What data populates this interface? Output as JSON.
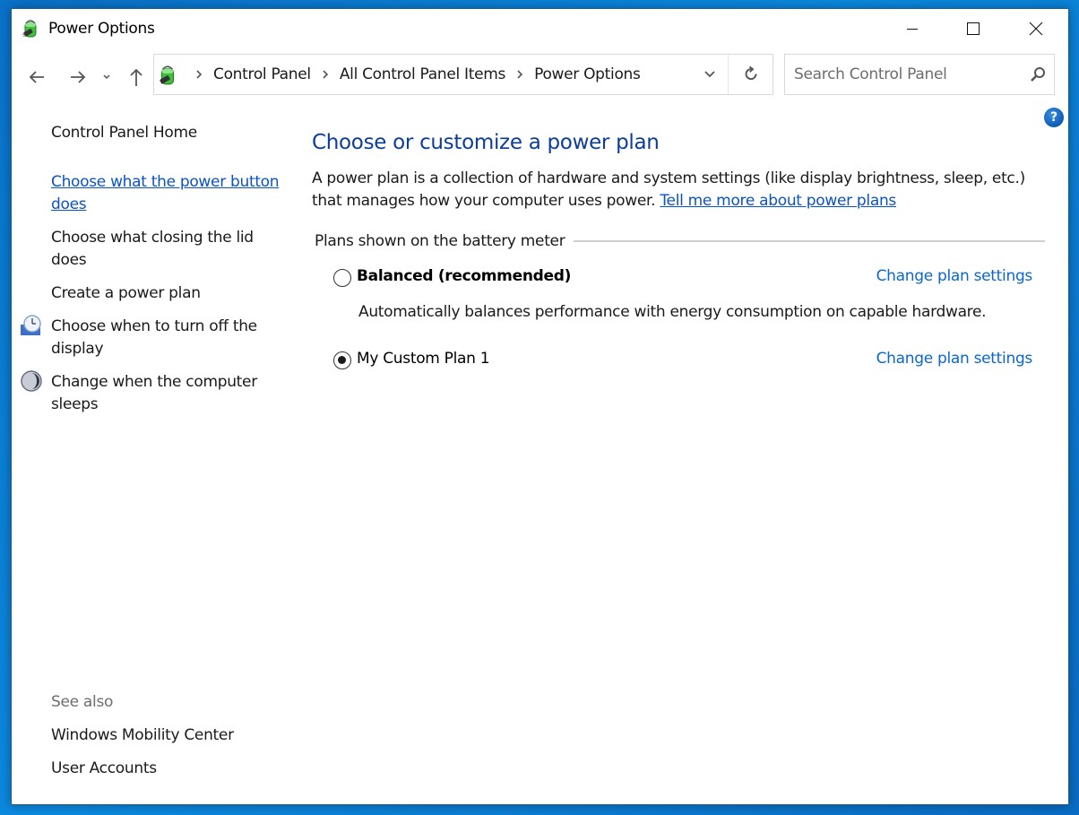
{
  "window": {
    "title": "Power Options",
    "controls": {
      "minimize": "minimize",
      "maximize": "maximize",
      "close": "close"
    }
  },
  "navigation": {
    "breadcrumbs": [
      "Control Panel",
      "All Control Panel Items",
      "Power Options"
    ],
    "search": {
      "placeholder": "Search Control Panel",
      "value": ""
    }
  },
  "sidebar": {
    "home_label": "Control Panel Home",
    "tasks": [
      {
        "label": "Choose what the power button does",
        "icon": null,
        "active": true
      },
      {
        "label": "Choose what closing the lid does",
        "icon": null,
        "active": false
      },
      {
        "label": "Create a power plan",
        "icon": null,
        "active": false
      },
      {
        "label": "Choose when to turn off the display",
        "icon": "display-clock-icon",
        "active": false
      },
      {
        "label": "Change when the computer sleeps",
        "icon": "sleep-moon-icon",
        "active": false
      }
    ],
    "see_also": {
      "title": "See also",
      "links": [
        "Windows Mobility Center",
        "User Accounts"
      ]
    }
  },
  "main": {
    "heading": "Choose or customize a power plan",
    "description": "A power plan is a collection of hardware and system settings (like display brightness, sleep, etc.) that manages how your computer uses power.",
    "learn_more_link": "Tell me more about power plans",
    "group_title": "Plans shown on the battery meter",
    "plans": [
      {
        "name": "Balanced (recommended)",
        "selected": false,
        "bold": true,
        "description": "Automatically balances performance with energy consumption on capable hardware.",
        "settings_link": "Change plan settings"
      },
      {
        "name": "My Custom Plan 1",
        "selected": true,
        "bold": false,
        "description": "",
        "settings_link": "Change plan settings"
      }
    ]
  },
  "colors": {
    "heading": "#0c3d9a",
    "link": "#0a66d1",
    "active_link": "#0a53c4",
    "desktop": "#0b7fd6"
  }
}
